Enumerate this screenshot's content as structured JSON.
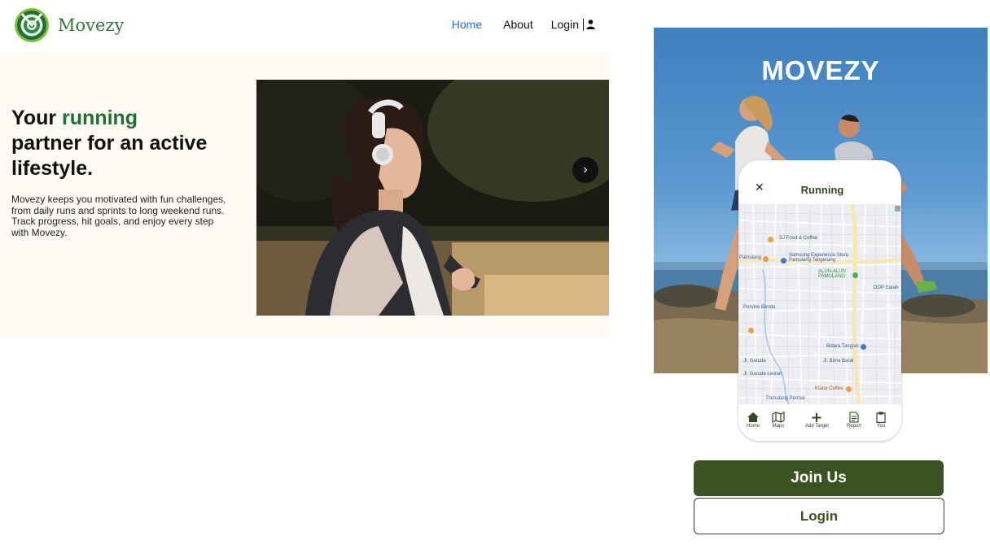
{
  "brand": {
    "name": "Movezy",
    "color": "#2f7a36"
  },
  "nav": {
    "items": [
      {
        "label": "Home",
        "active": true
      },
      {
        "label": "About",
        "active": false
      }
    ],
    "login_label": "Login",
    "login_icon": "user-icon"
  },
  "hero": {
    "title_prefix": "Your ",
    "title_accent": "running",
    "title_suffix": "partner for an active lifestyle.",
    "description": "Movezy keeps you motivated with fun challenges, from daily runs and sprints to long weekend runs. Track progress, hit goals, and enjoy every step with Movezy.",
    "next_icon": "chevron-right-icon"
  },
  "promo": {
    "title": "MOVEZY",
    "phone": {
      "close_icon": "close-icon",
      "title": "Running",
      "map_labels": [
        "SJ Food & Coffee",
        "Samsung Experience Store Pamulang Tangerang",
        "Pamulang",
        "ALUN-ALUN PAMULANG",
        "DOP Sarah",
        "Bidara Tangsel",
        "Jl. Bima Barat",
        "Jl. Garuda",
        "Jl. Garuda Lestari",
        "Klana Coffee",
        "Pamulang Permai",
        "Pondok Benda"
      ],
      "tabs": [
        {
          "label": "Home",
          "icon": "home-icon"
        },
        {
          "label": "Maps",
          "icon": "map-icon"
        },
        {
          "label": "Add Target",
          "icon": "plus-icon"
        },
        {
          "label": "Report",
          "icon": "report-icon"
        },
        {
          "label": "You",
          "icon": "clipboard-icon"
        }
      ]
    },
    "join_label": "Join Us",
    "login_label": "Login",
    "accent_color": "#3b5323"
  }
}
